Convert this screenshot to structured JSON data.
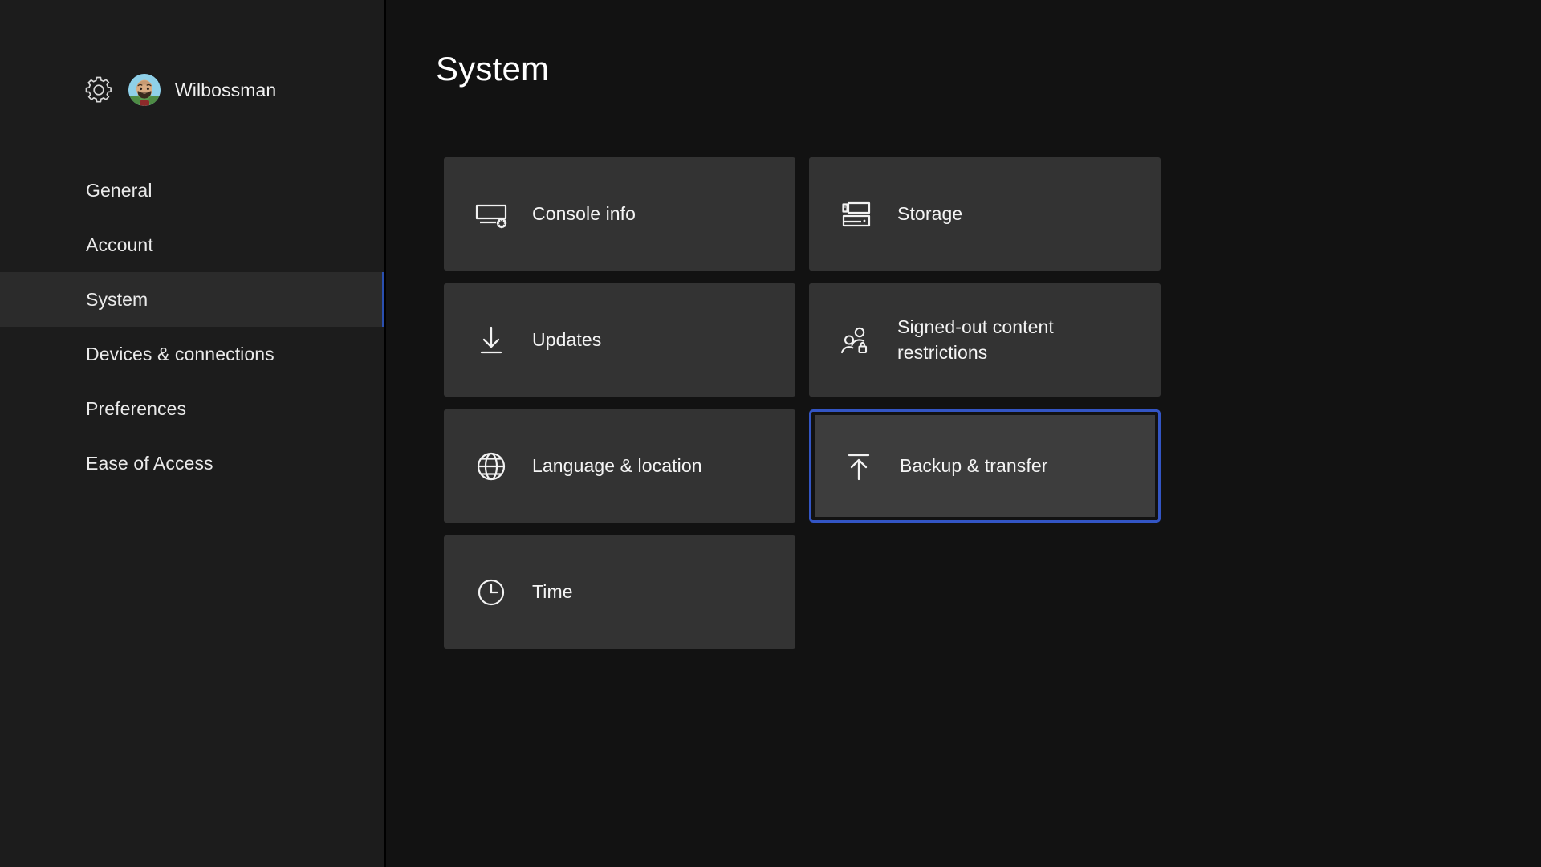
{
  "profile": {
    "gear_icon": "gear-icon",
    "avatar_icon": "avatar",
    "name": "Wilbossman"
  },
  "sidebar": {
    "items": [
      {
        "label": "General",
        "selected": false
      },
      {
        "label": "Account",
        "selected": false
      },
      {
        "label": "System",
        "selected": true
      },
      {
        "label": "Devices & connections",
        "selected": false
      },
      {
        "label": "Preferences",
        "selected": false
      },
      {
        "label": "Ease of Access",
        "selected": false
      }
    ]
  },
  "main": {
    "title": "System",
    "tiles": [
      {
        "label": "Console info",
        "icon": "console-info-icon",
        "focused": false
      },
      {
        "label": "Storage",
        "icon": "storage-icon",
        "focused": false
      },
      {
        "label": "Updates",
        "icon": "download-arrow-icon",
        "focused": false
      },
      {
        "label": "Signed-out content restrictions",
        "icon": "people-lock-icon",
        "focused": false
      },
      {
        "label": "Language & location",
        "icon": "globe-icon",
        "focused": false
      },
      {
        "label": "Backup & transfer",
        "icon": "upload-arrow-icon",
        "focused": true
      },
      {
        "label": "Time",
        "icon": "clock-icon",
        "focused": false
      }
    ]
  },
  "colors": {
    "accent_selection": "#3355c4",
    "sidebar_indicator": "#2a4fb0",
    "sidebar_bg": "#1c1c1c",
    "sidebar_selected_bg": "#2b2b2b",
    "tile_bg": "#333333",
    "tile_focused_bg": "#3d3d3d",
    "main_bg": "#121212",
    "text_primary": "#f4f4f4"
  }
}
